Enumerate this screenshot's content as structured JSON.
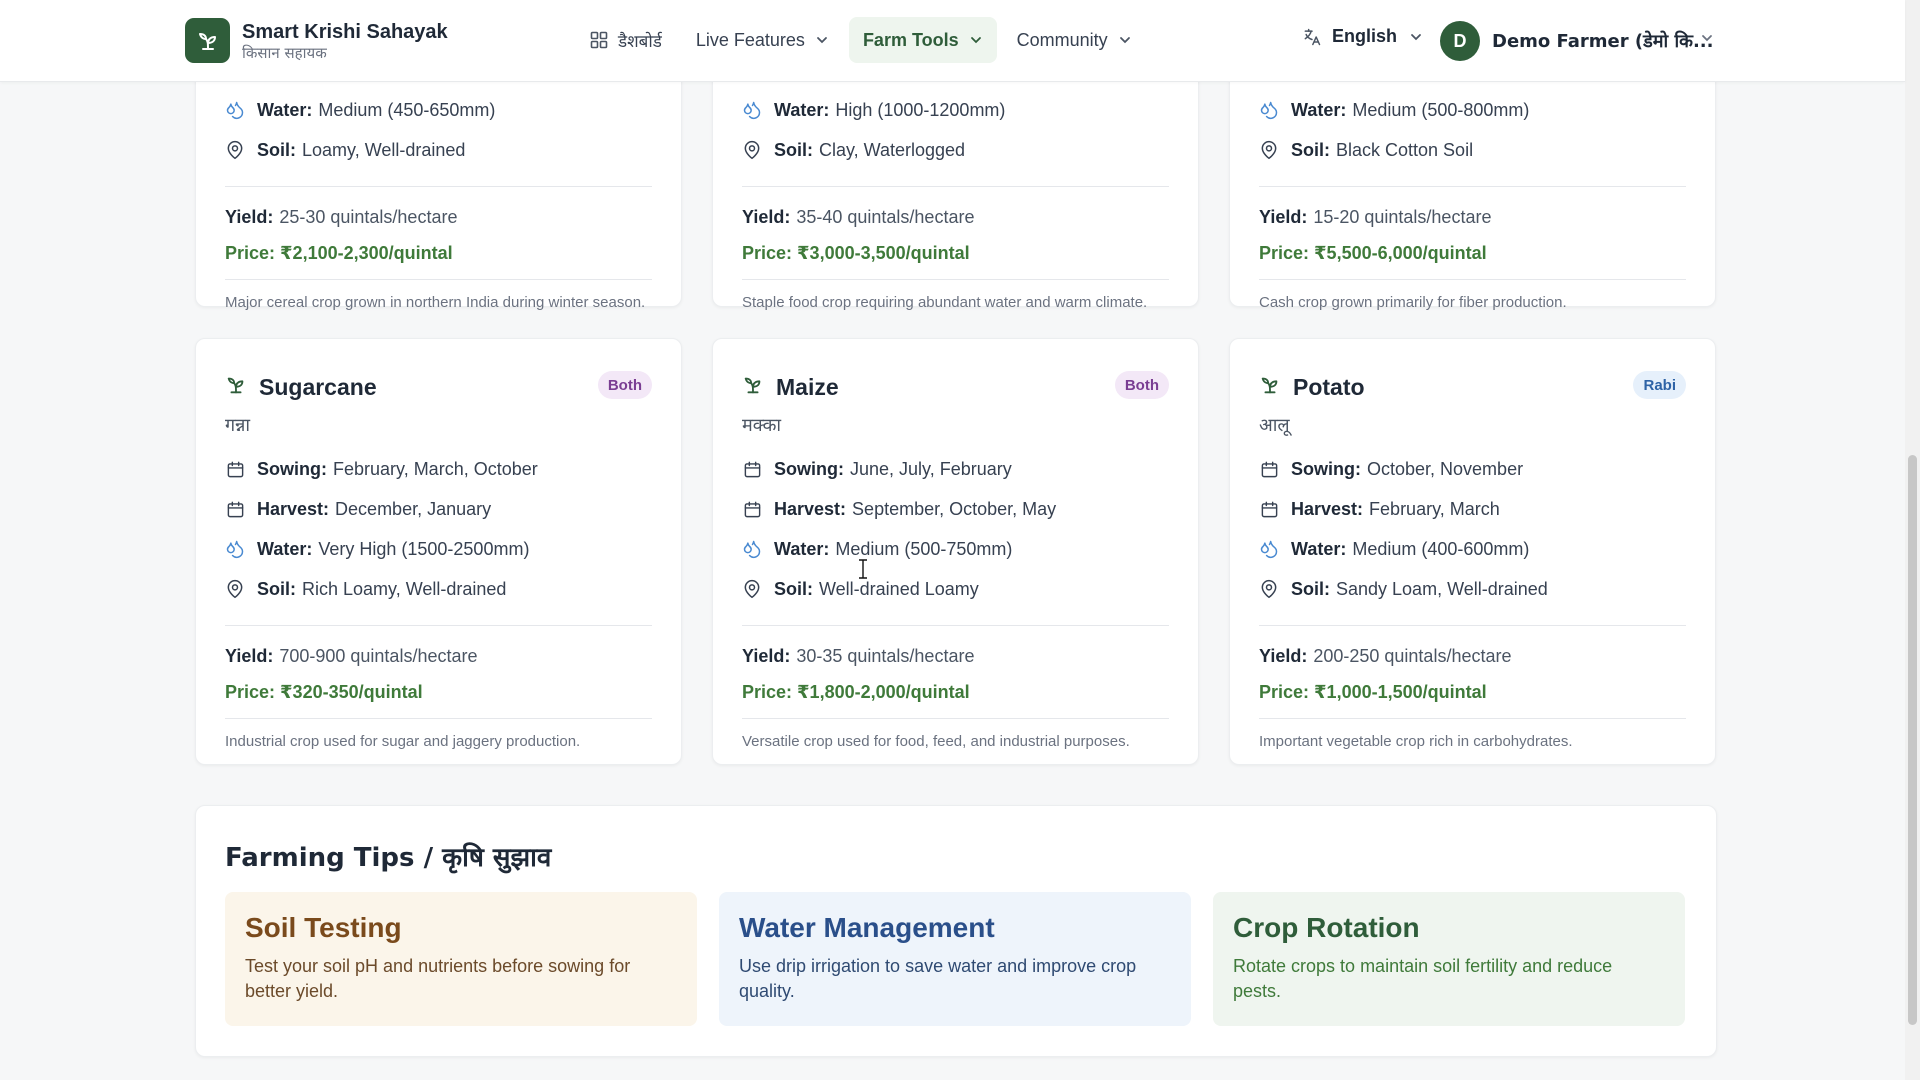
{
  "header": {
    "brand_title": "Smart Krishi Sahayak",
    "brand_subtitle": "किसान सहायक",
    "nav": {
      "dashboard": "डैशबोर्ड",
      "live_features": "Live Features",
      "farm_tools": "Farm Tools",
      "community": "Community"
    },
    "language": "English",
    "user_initial": "D",
    "user_name": "Demo Farmer (डेमो कि..."
  },
  "labels": {
    "sowing": "Sowing:",
    "harvest": "Harvest:",
    "water": "Water:",
    "soil": "Soil:",
    "yield": "Yield:"
  },
  "top_cards": [
    {
      "water": "Medium (450-650mm)",
      "soil": "Loamy, Well-drained",
      "yield": "25-30 quintals/hectare",
      "price": "Price: ₹2,100-2,300/quintal",
      "description": "Major cereal crop grown in northern India during winter season."
    },
    {
      "water": "High (1000-1200mm)",
      "soil": "Clay, Waterlogged",
      "yield": "35-40 quintals/hectare",
      "price": "Price: ₹3,000-3,500/quintal",
      "description": "Staple food crop requiring abundant water and warm climate."
    },
    {
      "water": "Medium (500-800mm)",
      "soil": "Black Cotton Soil",
      "yield": "15-20 quintals/hectare",
      "price": "Price: ₹5,500-6,000/quintal",
      "description": "Cash crop grown primarily for fiber production."
    }
  ],
  "crops": [
    {
      "name": "Sugarcane",
      "hindi": "गन्ना",
      "season": "Both",
      "sowing": "February, March, October",
      "harvest": "December, January",
      "water": "Very High (1500-2500mm)",
      "soil": "Rich Loamy, Well-drained",
      "yield": "700-900 quintals/hectare",
      "price": "Price: ₹320-350/quintal",
      "description": "Industrial crop used for sugar and jaggery production."
    },
    {
      "name": "Maize",
      "hindi": "मक्का",
      "season": "Both",
      "sowing": "June, July, February",
      "harvest": "September, October, May",
      "water": "Medium (500-750mm)",
      "soil": "Well-drained Loamy",
      "yield": "30-35 quintals/hectare",
      "price": "Price: ₹1,800-2,000/quintal",
      "description": "Versatile crop used for food, feed, and industrial purposes."
    },
    {
      "name": "Potato",
      "hindi": "आलू",
      "season": "Rabi",
      "sowing": "October, November",
      "harvest": "February, March",
      "water": "Medium (400-600mm)",
      "soil": "Sandy Loam, Well-drained",
      "yield": "200-250 quintals/hectare",
      "price": "Price: ₹1,000-1,500/quintal",
      "description": "Important vegetable crop rich in carbohydrates."
    }
  ],
  "tips": {
    "title": "Farming Tips / कृषि सुझाव",
    "items": [
      {
        "title": "Soil Testing",
        "text": "Test your soil pH and nutrients before sowing for better yield."
      },
      {
        "title": "Water Management",
        "text": "Use drip irrigation to save water and improve crop quality."
      },
      {
        "title": "Crop Rotation",
        "text": "Rotate crops to maintain soil fertility and reduce pests."
      }
    ]
  },
  "colors": {
    "brand_green": "#2f5d3a",
    "price_green": "#3f7a3a",
    "badge_both": "#7a3e93",
    "badge_rabi": "#2e63a6"
  }
}
